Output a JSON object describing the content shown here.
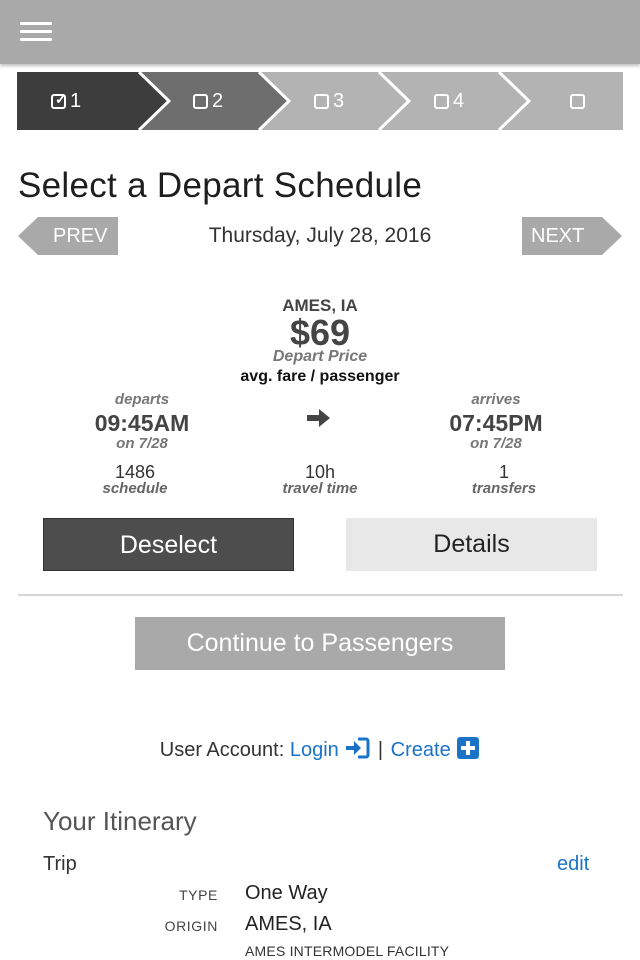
{
  "header": {
    "menu_icon": "hamburger-menu-icon"
  },
  "steps": [
    {
      "label": "1",
      "state": "completed",
      "icon": "checked-box-icon"
    },
    {
      "label": "2",
      "state": "pending",
      "icon": "empty-box-icon"
    },
    {
      "label": "3",
      "state": "pending",
      "icon": "empty-box-icon"
    },
    {
      "label": "4",
      "state": "pending",
      "icon": "empty-box-icon"
    },
    {
      "label": "",
      "state": "pending",
      "icon": "empty-box-icon"
    }
  ],
  "colors": {
    "topbar": "#a9a9a9",
    "step_active": "#3d3d3d",
    "step_second": "#6e6e6e",
    "step_pending": "#b3b3b3",
    "link": "#1a73c7",
    "deselect_bg": "#4d4d4d",
    "details_bg": "#e8e8e8"
  },
  "page_title": "Select a Depart Schedule",
  "date_nav": {
    "prev_label": "PREV",
    "next_label": "NEXT",
    "date": "Thursday, July 28, 2016"
  },
  "fare": {
    "origin": "AMES, IA",
    "price": "$69",
    "price_label": "Depart Price",
    "avg_fare_label": "avg. fare / passenger"
  },
  "schedule": {
    "departs_label": "departs",
    "depart_time": "09:45AM",
    "depart_date": "on 7/28",
    "arrow_icon": "arrow-right-icon",
    "arrives_label": "arrives",
    "arrive_time": "07:45PM",
    "arrive_date": "on 7/28",
    "schedule_number": "1486",
    "schedule_label": "schedule",
    "travel_time": "10h",
    "travel_time_label": "travel time",
    "transfers": "1",
    "transfers_label": "transfers"
  },
  "actions": {
    "deselect_label": "Deselect",
    "details_label": "Details",
    "continue_label": "Continue to Passengers"
  },
  "account": {
    "prefix": "User Account:",
    "login_label": "Login",
    "login_icon": "sign-in-icon",
    "separator": "|",
    "create_label": "Create",
    "create_icon": "plus-square-icon"
  },
  "itinerary": {
    "title": "Your Itinerary",
    "trip_label": "Trip",
    "edit_label": "edit",
    "type_key": "TYPE",
    "type_value": "One Way",
    "origin_key": "ORIGIN",
    "origin_value": "AMES, IA",
    "origin_facility": "AMES INTERMODEL FACILITY"
  }
}
